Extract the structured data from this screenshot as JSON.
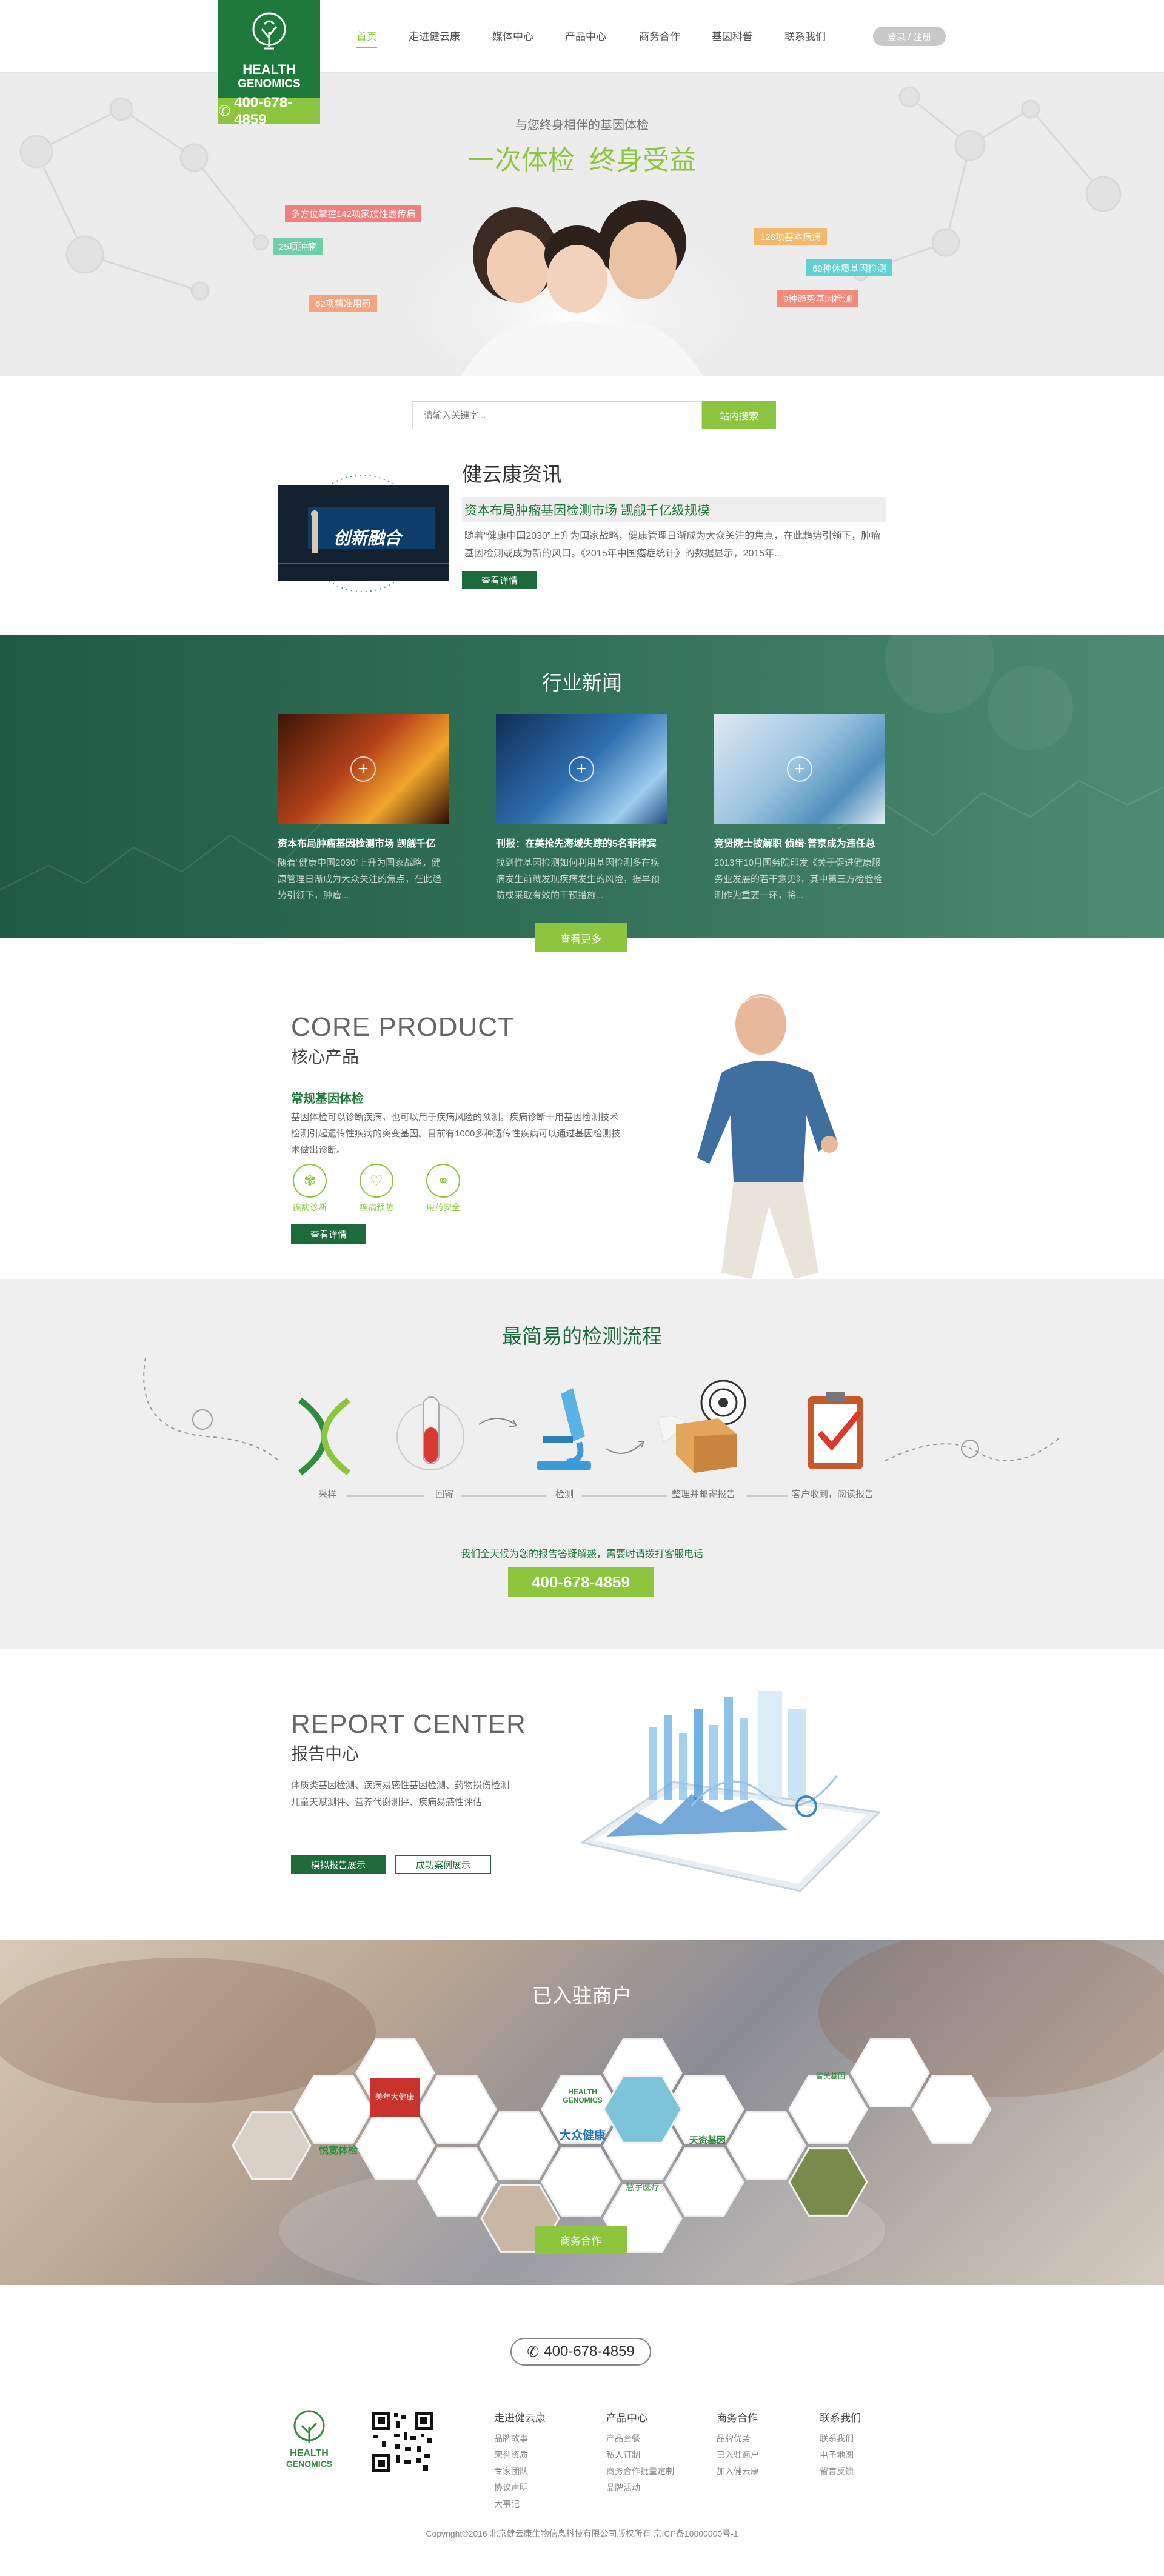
{
  "header": {
    "logo_line1": "HEALTH",
    "logo_line2": "GENOMICS",
    "logo_phone": "400-678-4859",
    "nav": [
      "首页",
      "走进健云康",
      "媒体中心",
      "产品中心",
      "商务合作",
      "基因科普",
      "联系我们"
    ],
    "login": "登录 / 注册"
  },
  "hero": {
    "subtitle": "与您终身相伴的基因体检",
    "title": "一次体检  终身受益",
    "tags": {
      "t1": "多方位掌控142项家族性遗传病",
      "t2": "25项肿瘤",
      "t3": "62项精准用药",
      "t4": "128项基本病病",
      "t5": "60种休质基因检测",
      "t6": "9种趋势基因检测"
    }
  },
  "search": {
    "placeholder": "请输入关键字...",
    "button": "站内搜索"
  },
  "news": {
    "heading": "健云康资讯",
    "title": "资本布局肿瘤基因检测市场 觊觎千亿级规模",
    "text": "随着“健康中国2030”上升为国家战略，健康管理日渐成为大众关注的焦点，在此趋势引领下，肿瘤基因检测或成为新的风口。《2015年中国癌症统计》的数据显示，2015年...",
    "button": "查看详情",
    "image_text": "创新融合"
  },
  "industry": {
    "heading": "行业新闻",
    "cards": [
      {
        "title": "资本布局肿瘤基因检测市场 觊觎千亿",
        "text": "随着“健康中国2030”上升为国家战略，健康管理日渐成为大众关注的焦点，在此趋势引领下，肿瘤..."
      },
      {
        "title": "刊报：在美抢先海域失踪的5名菲律宾",
        "text": "找到性基因检测如何利用基因检测多在疾病发生前就发现疾病发生的风险，提早预防或采取有效的干预措施..."
      },
      {
        "title": "竞贤院士披解职 侦缉·普京成为违任总",
        "text": "2013年10月国务院印发《关于促进健康服务业发展的若干意见》，其中第三方检验检测作为重要一环，将..."
      }
    ],
    "more": "查看更多"
  },
  "core": {
    "en": "CORE PRODUCT",
    "cn": "核心产品",
    "sub": "常规基因体检",
    "text": "基因体检可以诊断疾病，也可以用于疾病风险的预测。疾病诊断十用基因检测技术检测引起遗传性疾病的突变基因。目前有1000多种遗传性疾病可以通过基因检测技术做出诊断。",
    "features": [
      "疾病诊断",
      "疾病预防",
      "用药安全"
    ],
    "button": "查看详情"
  },
  "process": {
    "title": "最简易的检测流程",
    "steps": [
      "采样",
      "回寄",
      "检测",
      "整理并邮寄报告",
      "客户收到，阅读报告"
    ],
    "note": "我们全天候为您的报告答疑解惑，需要时请拨打客服电话",
    "phone": "400-678-4859"
  },
  "report": {
    "en": "REPORT CENTER",
    "cn": "报告中心",
    "text1": "体质类基因检测、疾病易感性基因检测、药物损伤检测",
    "text2": "儿童天赋测评、营养代谢测评、疾病易感性评估",
    "btn1": "模拟报告展示",
    "btn2": "成功案例展示"
  },
  "merchants": {
    "title": "已入驻商户",
    "logos": {
      "l1": "悦宽体检",
      "l2": "美年大健康",
      "l3": "HEALTH GENOMICS",
      "l4": "大众健康",
      "l5": "天资基因",
      "l6": "慧宇医疗",
      "l7": "智美基因"
    },
    "button": "商务合作"
  },
  "footer": {
    "phone": "400-678-4859",
    "logo_line1": "HEALTH",
    "logo_line2": "GENOMICS",
    "columns": [
      {
        "title": "走进健云康",
        "items": [
          "品牌故事",
          "荣誉资质",
          "专家团队",
          "协议声明",
          "大事记"
        ]
      },
      {
        "title": "产品中心",
        "items": [
          "产品套餐",
          "私人订制",
          "商务合作批量定制",
          "品牌活动"
        ]
      },
      {
        "title": "商务合作",
        "items": [
          "品牌优势",
          "已入驻商户",
          "加入健云康"
        ]
      },
      {
        "title": "联系我们",
        "items": [
          "联系我们",
          "电子地图",
          "留言反馈"
        ]
      }
    ],
    "copyright": "Copyright©2016 北京健云康生物信息科技有限公司版权所有  京ICP备10000000号-1"
  },
  "colors": {
    "primary_green": "#1d7a3a",
    "accent_green": "#8cc63f"
  }
}
